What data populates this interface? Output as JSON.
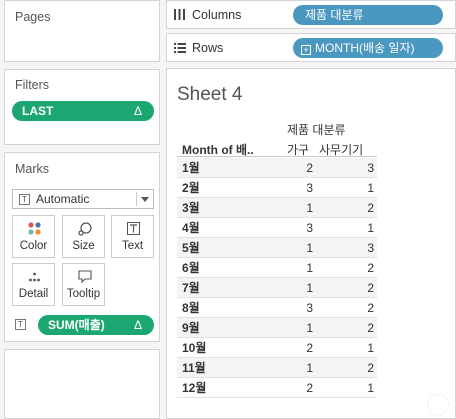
{
  "pages": {
    "title": "Pages"
  },
  "filters": {
    "title": "Filters",
    "pill": {
      "label": "LAST",
      "delta": "Δ"
    }
  },
  "marks": {
    "title": "Marks",
    "type_select": "Automatic",
    "buttons": {
      "color": "Color",
      "size": "Size",
      "text": "Text",
      "detail": "Detail",
      "tooltip": "Tooltip"
    },
    "text_pill": {
      "label": "SUM(매출)",
      "delta": "Δ"
    }
  },
  "columns": {
    "label": "Columns",
    "pill": "제품 대분류"
  },
  "rows": {
    "label": "Rows",
    "pill": "MONTH(배송 일자)"
  },
  "sheet": {
    "title": "Sheet 4",
    "col_group_header": "제품 대분류",
    "row_header": "Month of 배..",
    "col_headers": [
      "가구",
      "사무기기"
    ],
    "rows": [
      {
        "month": "1월",
        "v": [
          "2",
          "3"
        ]
      },
      {
        "month": "2월",
        "v": [
          "3",
          "1"
        ]
      },
      {
        "month": "3월",
        "v": [
          "1",
          "2"
        ]
      },
      {
        "month": "4월",
        "v": [
          "3",
          "1"
        ]
      },
      {
        "month": "5월",
        "v": [
          "1",
          "3"
        ]
      },
      {
        "month": "6월",
        "v": [
          "1",
          "2"
        ]
      },
      {
        "month": "7월",
        "v": [
          "1",
          "2"
        ]
      },
      {
        "month": "8월",
        "v": [
          "3",
          "2"
        ]
      },
      {
        "month": "9월",
        "v": [
          "1",
          "2"
        ]
      },
      {
        "month": "10월",
        "v": [
          "2",
          "1"
        ]
      },
      {
        "month": "11월",
        "v": [
          "1",
          "2"
        ]
      },
      {
        "month": "12월",
        "v": [
          "2",
          "1"
        ]
      }
    ]
  }
}
